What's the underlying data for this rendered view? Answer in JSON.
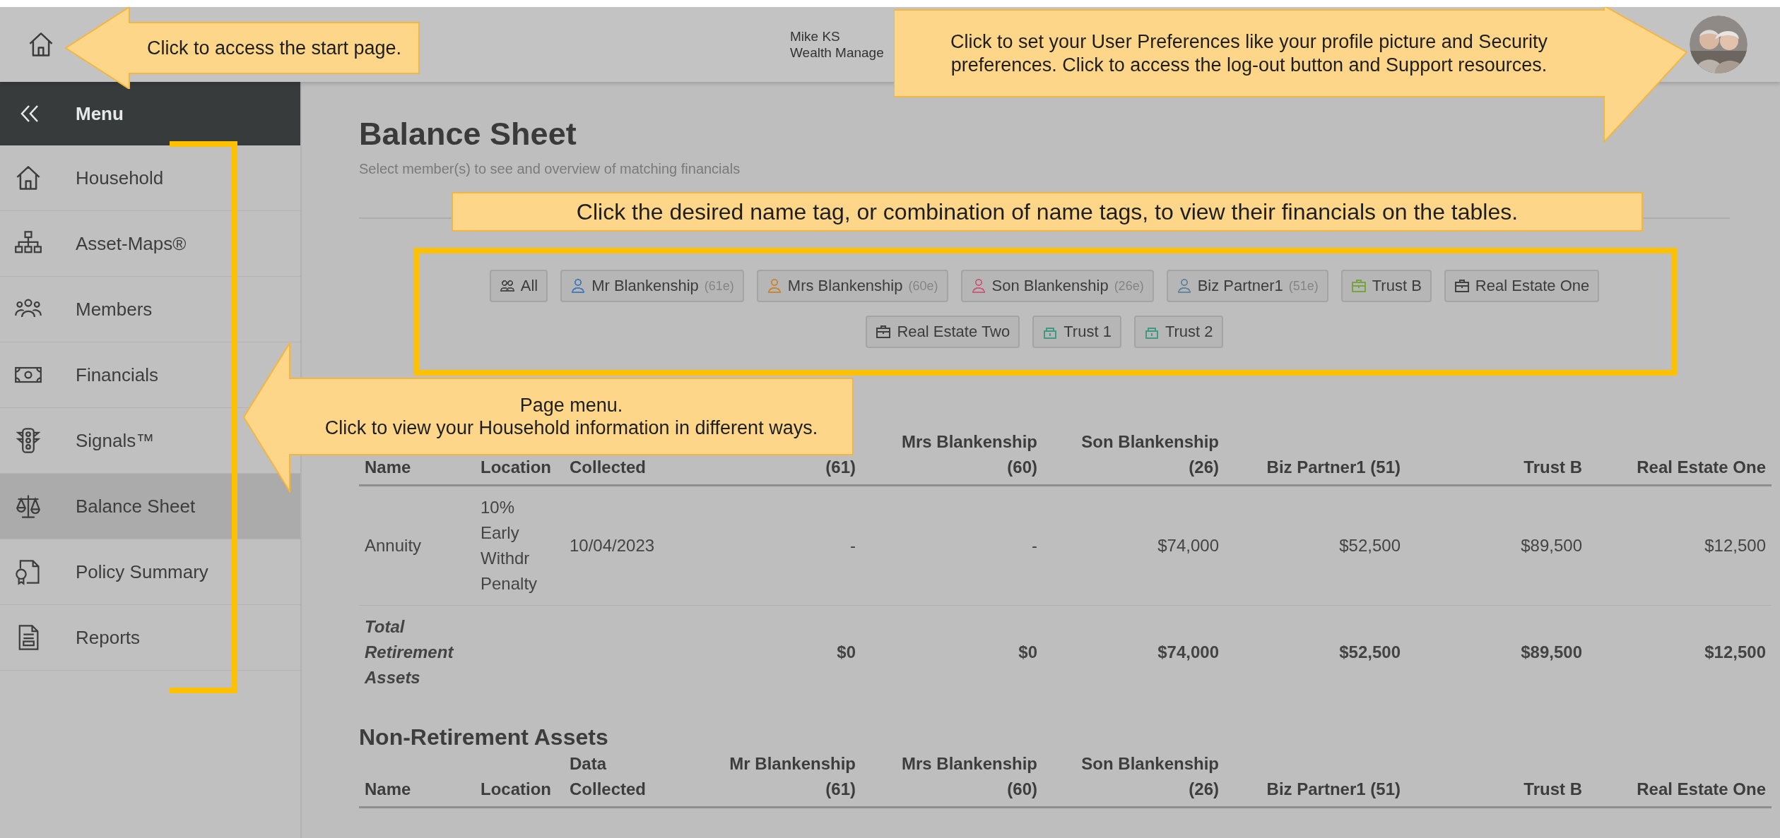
{
  "header": {
    "user_name": "Mike KS",
    "user_role": "Wealth Manage"
  },
  "sidebar": {
    "menu_label": "Menu",
    "items": [
      {
        "kind": "home",
        "label": "Household",
        "selected": false
      },
      {
        "kind": "org",
        "label": "Asset-Maps®",
        "selected": false
      },
      {
        "kind": "people",
        "label": "Members",
        "selected": false
      },
      {
        "kind": "money",
        "label": "Financials",
        "selected": false
      },
      {
        "kind": "signal",
        "label": "Signals™",
        "selected": false
      },
      {
        "kind": "scales",
        "label": "Balance Sheet",
        "selected": true
      },
      {
        "kind": "policy",
        "label": "Policy Summary",
        "selected": false
      },
      {
        "kind": "report",
        "label": "Reports",
        "selected": false
      }
    ]
  },
  "page": {
    "title": "Balance Sheet",
    "subtitle": "Select member(s) to see and overview of matching financials"
  },
  "tag_rows": [
    [
      {
        "kind": "group",
        "label": "All",
        "color": "#505050",
        "selected": false
      },
      {
        "kind": "person",
        "label": "Mr Blankenship",
        "age": "(61e)",
        "color": "#4a7cb8",
        "selected": false
      },
      {
        "kind": "person",
        "label": "Mrs Blankenship",
        "age": "(60e)",
        "color": "#c9873a",
        "selected": false
      },
      {
        "kind": "person",
        "label": "Son Blankenship",
        "age": "(26e)",
        "color": "#c95f7c",
        "selected": false
      },
      {
        "kind": "person",
        "label": "Biz Partner1",
        "age": "(51e)",
        "color": "#66869c",
        "selected": false
      },
      {
        "kind": "business",
        "label": "Trust B",
        "color": "#76a540",
        "selected": false
      },
      {
        "kind": "business",
        "label": "Real Estate One",
        "color": "#404040",
        "selected": false
      }
    ],
    [
      {
        "kind": "business",
        "label": "Real Estate Two",
        "color": "#404040",
        "selected": false
      },
      {
        "kind": "trust",
        "label": "Trust 1",
        "color": "#3f9a82",
        "selected": false
      },
      {
        "kind": "trust",
        "label": "Trust 2",
        "color": "#3f9a82",
        "selected": false
      }
    ]
  ],
  "sections": [
    {
      "columns": [
        [
          "Name"
        ],
        [
          "Location"
        ],
        [
          "Collected"
        ],
        [
          "(61)"
        ],
        [
          "Mrs Blankenship",
          "(60)"
        ],
        [
          "Son Blankenship",
          "(26)"
        ],
        [
          "Biz Partner1 (51)"
        ],
        [
          "Trust B"
        ],
        [
          "Real Estate One"
        ]
      ],
      "rows": [
        {
          "kind": "item",
          "cells": [
            "Annuity",
            "10% Early Withdr Penalty",
            "10/04/2023",
            "-",
            "-",
            "$74,000",
            "$52,500",
            "$89,500",
            "$12,500"
          ]
        },
        {
          "kind": "total",
          "label": "Total Retirement Assets",
          "values": [
            "$0",
            "$0",
            "$74,000",
            "$52,500",
            "$89,500",
            "$12,500"
          ]
        }
      ]
    },
    {
      "title": "Non-Retirement Assets",
      "columns": [
        [
          "Name"
        ],
        [
          "Location"
        ],
        [
          "Data",
          "Collected"
        ],
        [
          "Mr Blankenship",
          "(61)"
        ],
        [
          "Mrs Blankenship",
          "(60)"
        ],
        [
          "Son Blankenship",
          "(26)"
        ],
        [
          "Biz Partner1 (51)"
        ],
        [
          "Trust B"
        ],
        [
          "Real Estate One"
        ]
      ]
    }
  ],
  "callouts": [
    {
      "kind": "arrow-left",
      "text": "Click to access the start page."
    },
    {
      "kind": "arrow-right",
      "text": "Click to set your User Preferences like your profile picture and Security preferences. Click to access the log-out button and Support resources."
    },
    {
      "kind": "box",
      "text": "Click the desired name tag, or combination of name tags, to view their financials on the tables."
    },
    {
      "kind": "arrow-left",
      "heading": "Page menu.",
      "text": "Click to view your Household information in different ways."
    }
  ]
}
